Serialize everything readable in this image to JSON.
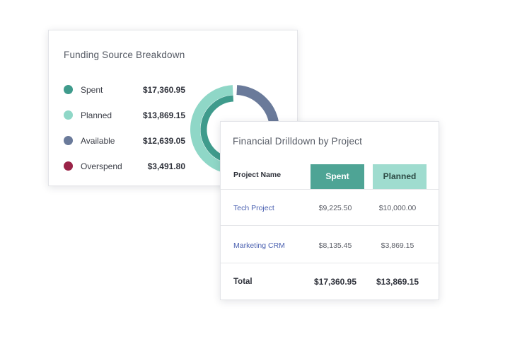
{
  "funding": {
    "title": "Funding Source Breakdown",
    "items": [
      {
        "label": "Spent",
        "amount": "$17,360.95",
        "value": 17360.95,
        "color": "#3f9b8c"
      },
      {
        "label": "Planned",
        "amount": "$13,869.15",
        "value": 13869.15,
        "color": "#8fd7c7"
      },
      {
        "label": "Available",
        "amount": "$12,639.05",
        "value": 12639.05,
        "color": "#6a7a9a"
      },
      {
        "label": "Overspend",
        "amount": "$3,491.80",
        "value": 3491.8,
        "color": "#9a2347"
      }
    ]
  },
  "drilldown": {
    "title": "Financial Drilldown by Project",
    "columns": {
      "name": "Project Name",
      "spent": "Spent",
      "planned": "Planned"
    },
    "rows": [
      {
        "name": "Tech Project",
        "spent": "$9,225.50",
        "planned": "$10,000.00"
      },
      {
        "name": "Marketing CRM",
        "spent": "$8,135.45",
        "planned": "$3,869.15"
      }
    ],
    "total": {
      "label": "Total",
      "spent": "$17,360.95",
      "planned": "$13,869.15"
    }
  }
}
